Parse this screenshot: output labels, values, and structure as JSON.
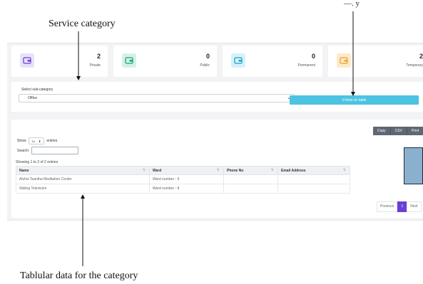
{
  "annotations": {
    "service_category": "Service category",
    "tabular_data": "Tablular data for the category",
    "top_right_fragment": "—. y"
  },
  "stats": [
    {
      "value": "2",
      "label": "Private",
      "color": "#6a3fd7",
      "bg": "#e7e2fb",
      "icon": "wallet-icon"
    },
    {
      "value": "0",
      "label": "Public",
      "color": "#1aa37a",
      "bg": "#d3f2e7",
      "icon": "wallet-icon"
    },
    {
      "value": "0",
      "label": "Permanent",
      "color": "#1ea3c9",
      "bg": "#d6f1f9",
      "icon": "wallet-icon"
    },
    {
      "value": "2",
      "label": "Temporary",
      "color": "#f0a32b",
      "bg": "#fdeacb",
      "icon": "wallet-icon"
    }
  ],
  "filter": {
    "label": "Select sub-category",
    "selected": "Office",
    "view_button": "⟳View on table"
  },
  "export_buttons": [
    "Copy",
    "CSV",
    "Print"
  ],
  "table_controls": {
    "show_prefix": "Show",
    "page_size": "10",
    "show_suffix": "entries",
    "search_label": "Search:",
    "info": "Showing 1 to 2 of 2 entries"
  },
  "table": {
    "columns": [
      "Name",
      "Ward",
      "Phone No",
      "Email Address"
    ],
    "rows": [
      [
        "Alshoi Taantha Meditation Center",
        "Ward number - 9",
        "",
        ""
      ],
      [
        "Waling Television",
        "Ward number - 8",
        "",
        ""
      ]
    ]
  },
  "pagination": {
    "previous": "Previous",
    "current": "1",
    "next": "Next"
  }
}
